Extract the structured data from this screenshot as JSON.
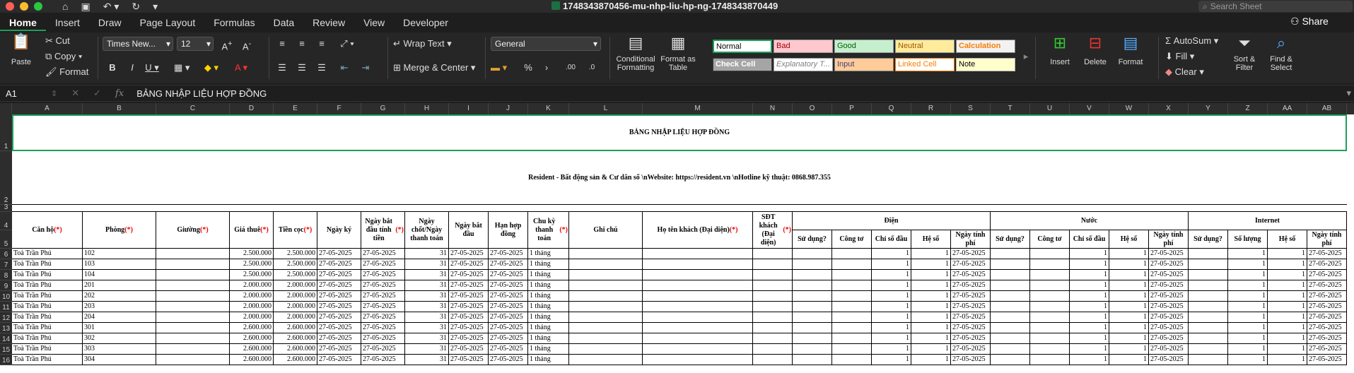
{
  "window": {
    "title": "1748343870456-mu-nhp-liu-hp-ng-1748343870449",
    "search_placeholder": "Search Sheet",
    "share_label": "Share"
  },
  "tabs": [
    "Home",
    "Insert",
    "Draw",
    "Page Layout",
    "Formulas",
    "Data",
    "Review",
    "View",
    "Developer"
  ],
  "ribbon": {
    "paste": "Paste",
    "cut": "Cut",
    "copy": "Copy",
    "format": "Format",
    "font_name": "Times New...",
    "font_size": "12",
    "wrap_text": "Wrap Text",
    "merge_center": "Merge & Center",
    "number_format": "General",
    "conditional_formatting": "Conditional Formatting",
    "format_as_table": "Format as Table",
    "styles": [
      {
        "label": "Normal",
        "bg": "#ffffff",
        "fg": "#000000",
        "border": "#1d9e5a"
      },
      {
        "label": "Bad",
        "bg": "#ffc7ce",
        "fg": "#9c0006",
        "border": "#999"
      },
      {
        "label": "Good",
        "bg": "#c6efce",
        "fg": "#006100",
        "border": "#999"
      },
      {
        "label": "Neutral",
        "bg": "#ffeb9c",
        "fg": "#9c5700",
        "border": "#999"
      },
      {
        "label": "Calculation",
        "bg": "#f2f2f2",
        "fg": "#fa7d00",
        "border": "#7f7f7f"
      },
      {
        "label": "Check Cell",
        "bg": "#a5a5a5",
        "fg": "#ffffff",
        "border": "#3f3f3f"
      },
      {
        "label": "Explanatory T...",
        "bg": "#ffffff",
        "fg": "#7f7f7f",
        "border": "#999"
      },
      {
        "label": "Input",
        "bg": "#ffcc99",
        "fg": "#3f3f76",
        "border": "#7f7f7f"
      },
      {
        "label": "Linked Cell",
        "bg": "#ffffff",
        "fg": "#fa7d00",
        "border": "#fa7d00"
      },
      {
        "label": "Note",
        "bg": "#ffffcc",
        "fg": "#000000",
        "border": "#b2b2b2"
      }
    ],
    "insert": "Insert",
    "delete": "Delete",
    "format_cells": "Format",
    "autosum": "AutoSum",
    "fill": "Fill",
    "clear": "Clear",
    "sort_filter": "Sort & Filter",
    "find_select": "Find & Select"
  },
  "formula_bar": {
    "name_box": "A1",
    "fx": "fx",
    "content": "BẢNG NHẬP LIỆU HỢP ĐỒNG"
  },
  "columns": [
    "A",
    "B",
    "C",
    "D",
    "E",
    "F",
    "G",
    "H",
    "I",
    "J",
    "K",
    "L",
    "M",
    "N",
    "O",
    "P",
    "Q",
    "R",
    "S",
    "T",
    "U",
    "V",
    "W",
    "X",
    "Y",
    "Z",
    "AA",
    "AB"
  ],
  "sheet": {
    "title": "BẢNG NHẬP LIỆU HỢP ĐỒNG",
    "subtitle": "Resident - Bất động sản & Cư dân số \\nWebsite: https://resident.vn \\nHotline kỹ thuật: 0868.987.355",
    "headers": {
      "A": "Căn hộ",
      "B": "Phòng",
      "C": "Giường",
      "D": "Giá thuê",
      "E": "Tiền cọc",
      "F": "Ngày ký",
      "G": "Ngày bắt đầu tính tiền",
      "H": "Ngày chốt/Ngày thanh toán",
      "I": "Ngày bắt đầu",
      "J": "Hạn hợp đồng",
      "K": "Chu kỳ thanh toán",
      "L": "Ghi chú",
      "M": "Họ tên khách (Đại diện)",
      "N": "SĐT khách (Đại diện)",
      "group_dien": "Điện",
      "group_nuoc": "Nước",
      "group_internet": "Internet",
      "su_dung": "Sử dụng?",
      "cong_to": "Công tơ",
      "chi_so_dau": "Chỉ số đầu",
      "he_so": "Hệ số",
      "ngay_tinh_phi": "Ngày tính phí",
      "so_luong": "Số lượng"
    },
    "req_mark": "(*)",
    "rows": [
      {
        "r": "6",
        "can_ho": "Toà Trần Phú",
        "phong": "102",
        "gia": "2.500.000",
        "coc": "2.500.000",
        "ky": "27-05-2025",
        "bd_tinh": "27-05-2025",
        "chot": "31",
        "bd": "27-05-2025",
        "han": "27-05-2025",
        "chu_ky": "1 tháng"
      },
      {
        "r": "7",
        "can_ho": "Toà Trần Phú",
        "phong": "103",
        "gia": "2.500.000",
        "coc": "2.500.000",
        "ky": "27-05-2025",
        "bd_tinh": "27-05-2025",
        "chot": "31",
        "bd": "27-05-2025",
        "han": "27-05-2025",
        "chu_ky": "1 tháng"
      },
      {
        "r": "8",
        "can_ho": "Toà Trần Phú",
        "phong": "104",
        "gia": "2.500.000",
        "coc": "2.500.000",
        "ky": "27-05-2025",
        "bd_tinh": "27-05-2025",
        "chot": "31",
        "bd": "27-05-2025",
        "han": "27-05-2025",
        "chu_ky": "1 tháng"
      },
      {
        "r": "9",
        "can_ho": "Toà Trần Phú",
        "phong": "201",
        "gia": "2.000.000",
        "coc": "2.000.000",
        "ky": "27-05-2025",
        "bd_tinh": "27-05-2025",
        "chot": "31",
        "bd": "27-05-2025",
        "han": "27-05-2025",
        "chu_ky": "1 tháng"
      },
      {
        "r": "10",
        "can_ho": "Toà Trần Phú",
        "phong": "202",
        "gia": "2.000.000",
        "coc": "2.000.000",
        "ky": "27-05-2025",
        "bd_tinh": "27-05-2025",
        "chot": "31",
        "bd": "27-05-2025",
        "han": "27-05-2025",
        "chu_ky": "1 tháng"
      },
      {
        "r": "11",
        "can_ho": "Toà Trần Phú",
        "phong": "203",
        "gia": "2.000.000",
        "coc": "2.000.000",
        "ky": "27-05-2025",
        "bd_tinh": "27-05-2025",
        "chot": "31",
        "bd": "27-05-2025",
        "han": "27-05-2025",
        "chu_ky": "1 tháng"
      },
      {
        "r": "12",
        "can_ho": "Toà Trần Phú",
        "phong": "204",
        "gia": "2.000.000",
        "coc": "2.000.000",
        "ky": "27-05-2025",
        "bd_tinh": "27-05-2025",
        "chot": "31",
        "bd": "27-05-2025",
        "han": "27-05-2025",
        "chu_ky": "1 tháng"
      },
      {
        "r": "13",
        "can_ho": "Toà Trần Phú",
        "phong": "301",
        "gia": "2.600.000",
        "coc": "2.600.000",
        "ky": "27-05-2025",
        "bd_tinh": "27-05-2025",
        "chot": "31",
        "bd": "27-05-2025",
        "han": "27-05-2025",
        "chu_ky": "1 tháng"
      },
      {
        "r": "14",
        "can_ho": "Toà Trần Phú",
        "phong": "302",
        "gia": "2.600.000",
        "coc": "2.600.000",
        "ky": "27-05-2025",
        "bd_tinh": "27-05-2025",
        "chot": "31",
        "bd": "27-05-2025",
        "han": "27-05-2025",
        "chu_ky": "1 tháng"
      },
      {
        "r": "15",
        "can_ho": "Toà Trần Phú",
        "phong": "303",
        "gia": "2.600.000",
        "coc": "2.600.000",
        "ky": "27-05-2025",
        "bd_tinh": "27-05-2025",
        "chot": "31",
        "bd": "27-05-2025",
        "han": "27-05-2025",
        "chu_ky": "1 tháng"
      },
      {
        "r": "16",
        "can_ho": "Toà Trần Phú",
        "phong": "304",
        "gia": "2.600.000",
        "coc": "2.600.000",
        "ky": "27-05-2025",
        "bd_tinh": "27-05-2025",
        "chot": "31",
        "bd": "27-05-2025",
        "han": "27-05-2025",
        "chu_ky": "1 tháng"
      }
    ],
    "util_chi_so": "1",
    "util_he_so": "1",
    "util_ngay": "27-05-2025",
    "internet_so_luong": "1"
  },
  "row_labels": [
    "1",
    "2",
    "3",
    "4",
    "5"
  ],
  "colors": {
    "accent": "#1d9e5a",
    "required": "#e00000"
  }
}
